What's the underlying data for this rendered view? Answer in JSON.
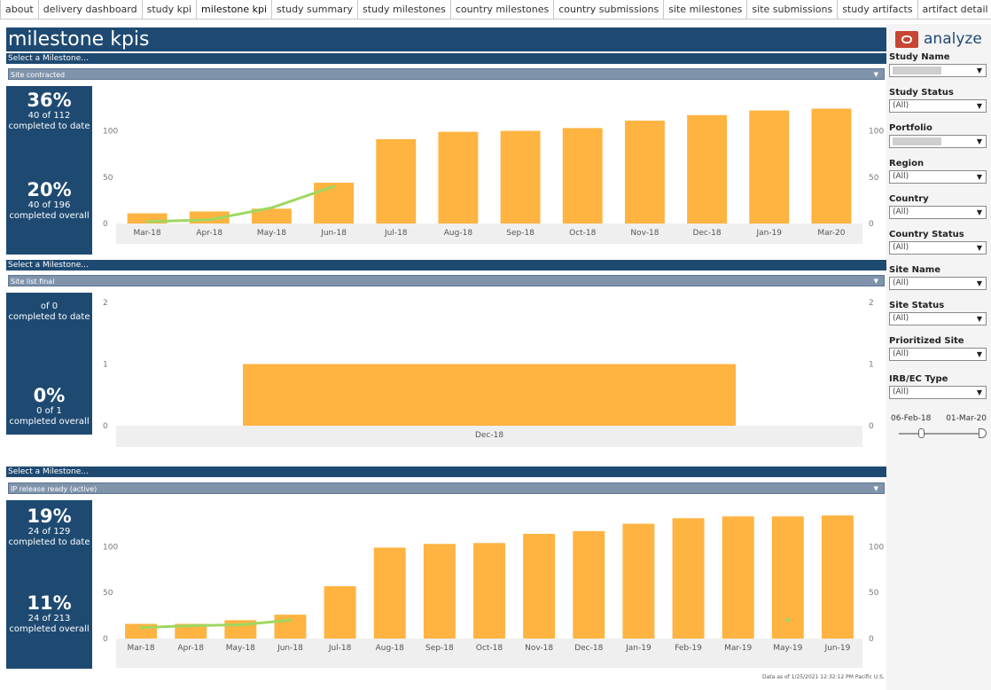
{
  "tabs": [
    "about",
    "delivery dashboard",
    "study kpi",
    "milestone kpi",
    "study summary",
    "study milestones",
    "country milestones",
    "country submissions",
    "site milestones",
    "site submissions",
    "study artifacts",
    "artifact detail",
    "_doc"
  ],
  "active_tab": "milestone kpi",
  "header": {
    "title": "milestone kpis"
  },
  "brand": {
    "name": "analyze",
    "logo_color": "#c74634"
  },
  "colors": {
    "navy": "#1e4a72",
    "bar": "#ffb340",
    "trend": "#9fd760",
    "select": "#7f93ab"
  },
  "sections": [
    {
      "label": "Select a Milestone...",
      "selected": "Site contracted",
      "kpi": {
        "todate_pct": "36%",
        "todate_count": "40 of 112",
        "todate_text": "completed to date",
        "overall_pct": "20%",
        "overall_count": "40 of 196",
        "overall_text": "completed overall"
      }
    },
    {
      "label": "Select a Milestone...",
      "selected": "Site list final",
      "kpi": {
        "todate_pct": "",
        "todate_count": "of 0",
        "todate_text": "completed to date",
        "overall_pct": "0%",
        "overall_count": "0 of 1",
        "overall_text": "completed overall"
      }
    },
    {
      "label": "Select a Milestone...",
      "selected": "IP release ready (active)",
      "kpi": {
        "todate_pct": "19%",
        "todate_count": "24 of 129",
        "todate_text": "completed to date",
        "overall_pct": "11%",
        "overall_count": "24 of 213",
        "overall_text": "completed overall"
      }
    }
  ],
  "chart_data": [
    {
      "type": "bar",
      "categories": [
        "Mar-18",
        "Apr-18",
        "May-18",
        "Jun-18",
        "Jul-18",
        "Aug-18",
        "Sep-18",
        "Oct-18",
        "Nov-18",
        "Dec-18",
        "Jan-19",
        "Mar-20"
      ],
      "values": [
        11,
        13,
        16,
        44,
        91,
        99,
        100,
        103,
        111,
        117,
        122,
        124
      ],
      "trend": [
        [
          0,
          2
        ],
        [
          1,
          4
        ],
        [
          2,
          17
        ],
        [
          3,
          40
        ]
      ],
      "yticks": [
        0,
        50,
        100
      ],
      "ylim": [
        0,
        135
      ]
    },
    {
      "type": "bar",
      "categories": [
        "Dec-18"
      ],
      "values": [
        1
      ],
      "yticks": [
        0,
        1,
        2
      ],
      "ylim": [
        0,
        2
      ]
    },
    {
      "type": "bar",
      "categories": [
        "Mar-18",
        "Apr-18",
        "May-18",
        "Jun-18",
        "Jul-18",
        "Aug-18",
        "Sep-18",
        "Oct-18",
        "Nov-18",
        "Dec-18",
        "Jan-19",
        "Feb-19",
        "Mar-19",
        "May-19",
        "Jun-19"
      ],
      "values": [
        16,
        16,
        20,
        26,
        57,
        99,
        103,
        104,
        114,
        117,
        125,
        131,
        133,
        133,
        134
      ],
      "trend": [
        [
          0,
          12
        ],
        [
          1,
          14
        ],
        [
          2,
          15
        ],
        [
          3,
          20
        ]
      ],
      "points": [
        [
          13,
          20
        ]
      ],
      "yticks": [
        0,
        50,
        100
      ],
      "ylim": [
        0,
        140
      ]
    }
  ],
  "filters": [
    {
      "label": "Study Name",
      "value": ""
    },
    {
      "label": "Study Status",
      "value": "(All)"
    },
    {
      "label": "Portfolio",
      "value": ""
    },
    {
      "label": "Region",
      "value": "(All)"
    },
    {
      "label": "Country",
      "value": "(All)"
    },
    {
      "label": "Country Status",
      "value": "(All)"
    },
    {
      "label": "Site Name",
      "value": "(All)"
    },
    {
      "label": "Site Status",
      "value": "(All)"
    },
    {
      "label": "Prioritized Site",
      "value": "(All)"
    },
    {
      "label": "IRB/EC Type",
      "value": "(All)"
    }
  ],
  "date_range": {
    "start": "06-Feb-18",
    "end": "01-Mar-20"
  },
  "footer": "Data as of 1/25/2021 12:32:12 PM Pacific U.S."
}
